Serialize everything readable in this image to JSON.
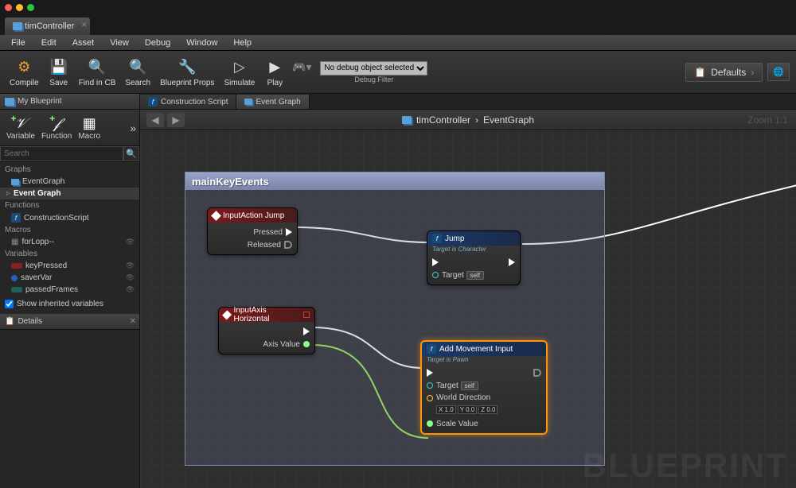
{
  "window": {
    "tab_title": "timController"
  },
  "menu": {
    "items": [
      "File",
      "Edit",
      "Asset",
      "View",
      "Debug",
      "Window",
      "Help"
    ]
  },
  "toolbar": {
    "compile": "Compile",
    "save": "Save",
    "find": "Find in CB",
    "search": "Search",
    "bp_props": "Blueprint Props",
    "simulate": "Simulate",
    "play": "Play",
    "debug_selected": "No debug object selected",
    "debug_label": "Debug Filter",
    "defaults": "Defaults"
  },
  "myblueprint": {
    "tab": "My Blueprint",
    "variable": "Variable",
    "function": "Function",
    "macro": "Macro",
    "search_placeholder": "Search",
    "sections": {
      "graphs": "Graphs",
      "functions": "Functions",
      "macros": "Macros",
      "variables": "Variables"
    },
    "items": {
      "eventgraph": "EventGraph",
      "event_graph_node": "Event Graph",
      "construction_script": "ConstructionScript",
      "forlopp": "forLopp--",
      "keyPressed": "keyPressed",
      "saverVar": "saverVar",
      "passedFrames": "passedFrames"
    },
    "show_inherited": "Show inherited variables"
  },
  "details": {
    "tab": "Details"
  },
  "graph": {
    "tabs": {
      "construction": "Construction Script",
      "eventgraph": "Event Graph"
    },
    "breadcrumb": {
      "parent": "timController",
      "child": "EventGraph"
    },
    "zoom": "Zoom 1:1",
    "watermark": "BLUEPRINT",
    "comment": "mainKeyEvents"
  },
  "nodes": {
    "input_jump": {
      "title": "InputAction Jump",
      "pressed": "Pressed",
      "released": "Released"
    },
    "jump": {
      "title": "Jump",
      "subtitle": "Target is Character",
      "target": "Target",
      "self": "self"
    },
    "input_axis": {
      "title": "InputAxis Horizontal",
      "axis_value": "Axis Value"
    },
    "add_movement": {
      "title": "Add Movement Input",
      "subtitle": "Target is Pawn",
      "target": "Target",
      "self": "self",
      "world_direction": "World Direction",
      "vec_x": "X 1.0",
      "vec_y": "Y 0.0",
      "vec_z": "Z 0.0",
      "scale_value": "Scale Value"
    }
  }
}
